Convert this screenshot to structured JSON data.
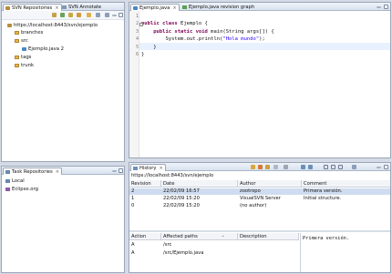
{
  "svn_panel": {
    "tabs": [
      {
        "label": "SVN Repositories"
      },
      {
        "label": "SVN Annotate"
      }
    ],
    "tree": [
      {
        "label": "https://localhost:8443/svn/ejemplo",
        "icon": "repository-icon"
      },
      {
        "label": "branches",
        "icon": "folder-icon"
      },
      {
        "label": "src",
        "icon": "folder-icon"
      },
      {
        "label": "Ejemplo.java 2",
        "icon": "java-file-icon"
      },
      {
        "label": "tags",
        "icon": "folder-icon"
      },
      {
        "label": "trunk",
        "icon": "folder-icon"
      }
    ]
  },
  "editor": {
    "tabs": [
      {
        "label": "Ejemplo.java"
      },
      {
        "label": "Ejemplo.java revision graph"
      }
    ],
    "gutter": [
      "1",
      "2",
      "3",
      "4",
      "5",
      "6"
    ],
    "lines": {
      "l1_kw": "public class",
      "l1_rest": " Ejemplo {",
      "l2_kw": "    public static void",
      "l2_rest": " main(String args[]) {",
      "l3_pre": "        System.out.println(",
      "l3_str": "\"Hola mundo\"",
      "l3_post": ");",
      "l4": "    }",
      "l5": "}"
    }
  },
  "task_panel": {
    "title": "Task Repositories",
    "items": [
      "Local",
      "Eclipse.org"
    ]
  },
  "history": {
    "title": "History",
    "url": "https://localhost:8443/svn/ejemplo",
    "columns": [
      "Revision",
      "Date",
      "Author",
      "Comment"
    ],
    "rows": [
      {
        "revision": "2",
        "date": "22/02/09 16:57",
        "author": "zootropo",
        "comment": "Primera versión."
      },
      {
        "revision": "1",
        "date": "22/02/09 15:20",
        "author": "VisualSVN Server",
        "comment": "Initial structure."
      },
      {
        "revision": "0",
        "date": "22/02/09 15:20",
        "author": "(no author)",
        "comment": ""
      }
    ],
    "path_columns": [
      "Action",
      "Affected paths",
      "Description"
    ],
    "paths": [
      {
        "action": "A",
        "path": "/src"
      },
      {
        "action": "A",
        "path": "/src/Ejemplo.java"
      }
    ],
    "comment_detail": "Primera versión."
  },
  "colors": {
    "accent": "#cfdcef",
    "keyword": "#7f0055",
    "string": "#2a00ff",
    "background": "#d4dbe6"
  }
}
